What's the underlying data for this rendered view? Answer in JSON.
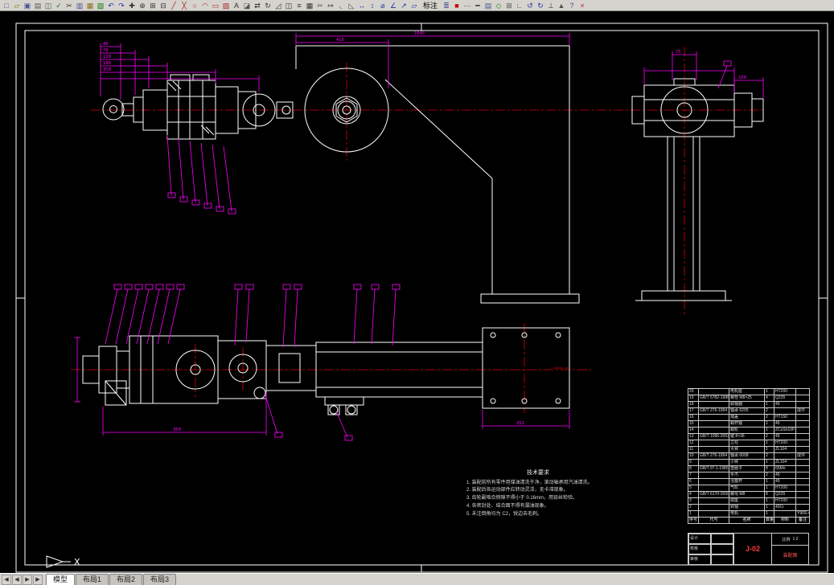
{
  "toolbar": {
    "annotation_label": "标注",
    "icons_left": [
      {
        "name": "new",
        "glyph": "□",
        "color": "#44518f"
      },
      {
        "name": "open",
        "glyph": "▱",
        "color": "#8a6d1f"
      },
      {
        "name": "save",
        "glyph": "▣",
        "color": "#44518f"
      },
      {
        "name": "print",
        "glyph": "▤",
        "color": "#555555"
      },
      {
        "name": "preview",
        "glyph": "◫",
        "color": "#555555"
      },
      {
        "name": "spell",
        "glyph": "✓",
        "color": "#0a7a0a"
      },
      {
        "name": "cut",
        "glyph": "✂",
        "color": "#333333"
      },
      {
        "name": "copy",
        "glyph": "▥",
        "color": "#44518f"
      },
      {
        "name": "paste",
        "glyph": "▦",
        "color": "#8a6d1f"
      },
      {
        "name": "match-properties",
        "glyph": "▧",
        "color": "#0a7a0a"
      },
      {
        "name": "undo",
        "glyph": "↶",
        "color": "#2233aa"
      },
      {
        "name": "redo",
        "glyph": "↷",
        "color": "#2233aa"
      },
      {
        "name": "pan",
        "glyph": "✚",
        "color": "#333333"
      },
      {
        "name": "zoom-realtime",
        "glyph": "⊕",
        "color": "#333333"
      },
      {
        "name": "zoom-window",
        "glyph": "⊞",
        "color": "#333333"
      },
      {
        "name": "zoom-previous",
        "glyph": "⊟",
        "color": "#333333"
      },
      {
        "name": "line",
        "glyph": "╱",
        "color": "#aa2222"
      },
      {
        "name": "polyline",
        "glyph": "╳",
        "color": "#aa2222"
      },
      {
        "name": "circle",
        "glyph": "○",
        "color": "#aa2222"
      },
      {
        "name": "arc",
        "glyph": "◠",
        "color": "#aa2222"
      },
      {
        "name": "rectangle",
        "glyph": "▭",
        "color": "#aa2222"
      },
      {
        "name": "hatch",
        "glyph": "▨",
        "color": "#aa2222"
      },
      {
        "name": "text",
        "glyph": "A",
        "color": "#333333"
      },
      {
        "name": "erase",
        "glyph": "◪",
        "color": "#555555"
      },
      {
        "name": "move",
        "glyph": "⇄",
        "color": "#333333"
      },
      {
        "name": "rotate",
        "glyph": "↻",
        "color": "#333333"
      },
      {
        "name": "scale",
        "glyph": "◿",
        "color": "#333333"
      },
      {
        "name": "mirror",
        "glyph": "◫",
        "color": "#333333"
      },
      {
        "name": "offset",
        "glyph": "≡",
        "color": "#333333"
      },
      {
        "name": "array",
        "glyph": "▦",
        "color": "#333333"
      },
      {
        "name": "trim",
        "glyph": "✂",
        "color": "#555555"
      },
      {
        "name": "extend",
        "glyph": "↦",
        "color": "#555555"
      },
      {
        "name": "fillet",
        "glyph": "◟",
        "color": "#555555"
      },
      {
        "name": "chamfer",
        "glyph": "◺",
        "color": "#555555"
      },
      {
        "name": "dim-linear",
        "glyph": "↔",
        "color": "#2233aa"
      },
      {
        "name": "dim-vertical",
        "glyph": "↕",
        "color": "#2233aa"
      },
      {
        "name": "dim-radius",
        "glyph": "⌀",
        "color": "#2233aa"
      },
      {
        "name": "dim-angular",
        "glyph": "∠",
        "color": "#2233aa"
      },
      {
        "name": "leader",
        "glyph": "↗",
        "color": "#2233aa"
      },
      {
        "name": "dim-style",
        "glyph": "▱",
        "color": "#2233aa"
      }
    ],
    "icons_right": [
      {
        "name": "layers",
        "glyph": "≣",
        "color": "#44518f"
      },
      {
        "name": "layer-color",
        "glyph": "■",
        "color": "#cc0000"
      },
      {
        "name": "linetype",
        "glyph": "⋯",
        "color": "#333333"
      },
      {
        "name": "lineweight",
        "glyph": "━",
        "color": "#333333"
      },
      {
        "name": "properties",
        "glyph": "▤",
        "color": "#44518f"
      },
      {
        "name": "osnap",
        "glyph": "◇",
        "color": "#0a7a0a"
      },
      {
        "name": "grid",
        "glyph": "⊞",
        "color": "#555555"
      },
      {
        "name": "ortho",
        "glyph": "∟",
        "color": "#555555"
      },
      {
        "name": "redraw",
        "glyph": "↺",
        "color": "#2233aa"
      },
      {
        "name": "regen",
        "glyph": "↻",
        "color": "#2233aa"
      },
      {
        "name": "ucs-toggle",
        "glyph": "⊥",
        "color": "#333333"
      },
      {
        "name": "view-top",
        "glyph": "▲",
        "color": "#555555"
      },
      {
        "name": "help",
        "glyph": "?",
        "color": "#44518f"
      },
      {
        "name": "close",
        "glyph": "×",
        "color": "#aa2222"
      }
    ]
  },
  "statusbar": {
    "nav": [
      "◀",
      "◀",
      "▶",
      "▶"
    ],
    "tabs": [
      "模型",
      "布局1",
      "布局2",
      "布局3"
    ],
    "active_tab": "模型"
  },
  "drawing": {
    "axis_label": "X",
    "dims": [
      "1045",
      "415",
      "350",
      "252",
      "180",
      "120",
      "75",
      "70",
      "160",
      "40"
    ],
    "notes": {
      "title": "技术要求",
      "lines": [
        "1. 装配前所有零件用煤油清洗干净，滚动轴承用汽油清洗。",
        "2. 装配后各运动部件应转动灵活，无卡滞现象。",
        "3. 齿轮副啮合侧隙不得小于 0.16mm，用铅丝检验。",
        "4. 各密封处、结合面不得有漏油现象。",
        "5. 未注倒角均为 C2，锐边去毛刺。"
      ]
    },
    "parts_table": {
      "headers": [
        "序号",
        "代号",
        "名称",
        "数量",
        "材料",
        "备注"
      ],
      "rows": [
        [
          "20",
          "",
          "电机座",
          "1",
          "HT200",
          ""
        ],
        [
          "19",
          "GB/T 5782-1986",
          "螺栓 M8×25",
          "4",
          "Q235",
          ""
        ],
        [
          "18",
          "",
          "联轴器",
          "1",
          "45",
          ""
        ],
        [
          "17",
          "GB/T 276-1994",
          "轴承 6205",
          "2",
          "",
          "成件"
        ],
        [
          "16",
          "",
          "端盖",
          "2",
          "HT150",
          ""
        ],
        [
          "15",
          "",
          "蜗杆轴",
          "1",
          "45",
          ""
        ],
        [
          "14",
          "",
          "蜗轮",
          "1",
          "ZCuSn10P1",
          ""
        ],
        [
          "13",
          "GB/T 1096-2003",
          "键 8×36",
          "2",
          "45",
          ""
        ],
        [
          "12",
          "",
          "立柱",
          "1",
          "HT200",
          ""
        ],
        [
          "11",
          "",
          "大臂",
          "1",
          "ZL104",
          ""
        ],
        [
          "10",
          "GB/T 276-1994",
          "轴承 6008",
          "2",
          "",
          "成件"
        ],
        [
          "9",
          "",
          "小臂",
          "1",
          "ZL104",
          ""
        ],
        [
          "8",
          "GB/T 97.1-1985",
          "垫圈 8",
          "8",
          "65Mn",
          ""
        ],
        [
          "7",
          "",
          "手爪",
          "2",
          "45",
          ""
        ],
        [
          "6",
          "",
          "活塞杆",
          "1",
          "45",
          ""
        ],
        [
          "5",
          "",
          "气缸",
          "1",
          "HT200",
          ""
        ],
        [
          "4",
          "GB/T 6170-2000",
          "螺母 M8",
          "8",
          "Q235",
          ""
        ],
        [
          "3",
          "",
          "底座",
          "1",
          "HT200",
          ""
        ],
        [
          "2",
          "",
          "转轴",
          "1",
          "40Cr",
          ""
        ],
        [
          "1",
          "",
          "电机",
          "1",
          "",
          "Y90S-4"
        ]
      ]
    },
    "title_block": {
      "rows_left": [
        "设计",
        "校核",
        "审核"
      ],
      "scale_label": "比例",
      "scale": "1:2",
      "drawing_no": "J-02",
      "title": "装配图"
    },
    "colors": {
      "background": "#000000",
      "line": "#ffffff",
      "dimension": "#ff00ff",
      "centerline": "#ff0000"
    }
  }
}
